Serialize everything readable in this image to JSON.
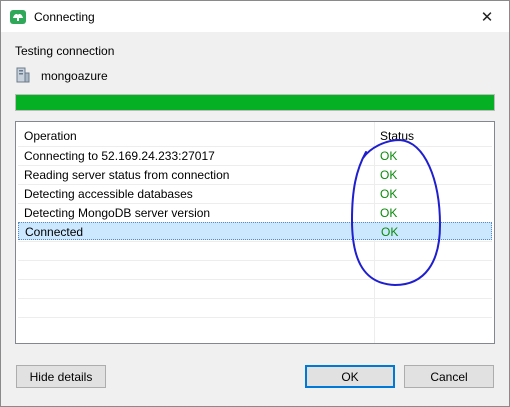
{
  "window": {
    "title": "Connecting",
    "close_glyph": "✕"
  },
  "heading": "Testing connection",
  "connection": {
    "name": "mongoazure",
    "icon": "server-icon"
  },
  "progress": {
    "percent": 100,
    "color": "#06b025"
  },
  "table": {
    "columns": [
      "Operation",
      "Status"
    ],
    "rows": [
      {
        "operation": "Connecting to 52.169.24.233:27017",
        "status": "OK"
      },
      {
        "operation": "Reading server status from connection",
        "status": "OK"
      },
      {
        "operation": "Detecting accessible databases",
        "status": "OK"
      },
      {
        "operation": "Detecting MongoDB server version",
        "status": "OK"
      },
      {
        "operation": "Connected",
        "status": "OK",
        "selected": true
      }
    ]
  },
  "buttons": {
    "hide_details": "Hide details",
    "ok": "OK",
    "cancel": "Cancel"
  },
  "colors": {
    "status_ok": "#0a8a0a",
    "selection": "#cce8ff",
    "annotation": "#1f1fcf"
  }
}
